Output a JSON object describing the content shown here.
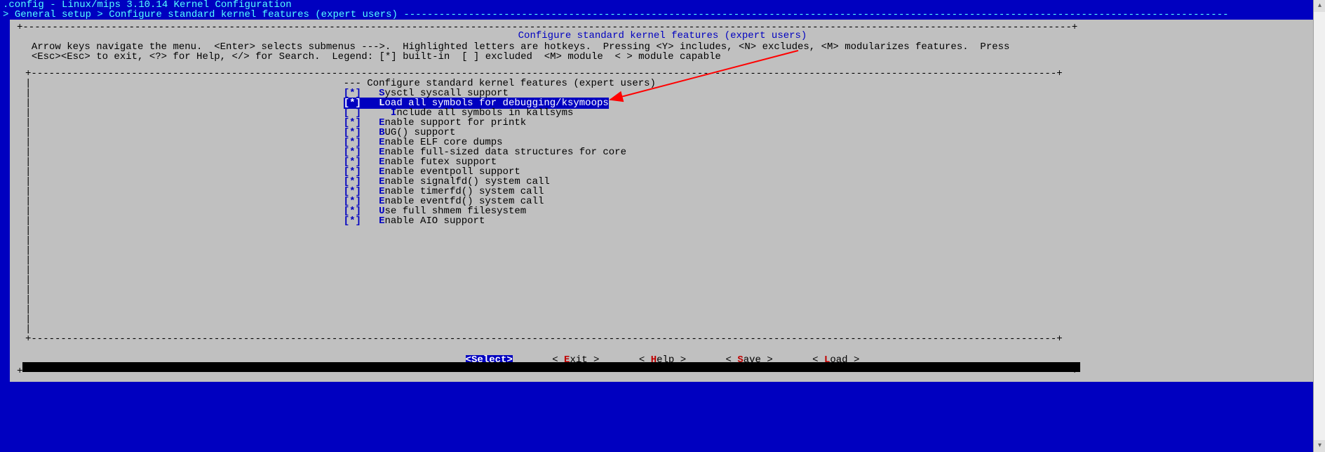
{
  "header": {
    "title": ".config - Linux/mips 3.10.14 Kernel Configuration",
    "breadcrumb_prefix": "> ",
    "breadcrumb": "General setup > Configure standard kernel features (expert users)"
  },
  "box": {
    "title": "Configure standard kernel features (expert users)",
    "help_line1": "  Arrow keys navigate the menu.  <Enter> selects submenus --->.  Highlighted letters are hotkeys.  Pressing <Y> includes, <N> excludes, <M> modularizes features.  Press",
    "help_line2": "  <Esc><Esc> to exit, <?> for Help, </> for Search.  Legend: [*] built-in  [ ] excluded  <M> module  < > module capable"
  },
  "menu": {
    "header_text": "--- Configure standard kernel features (expert users)",
    "items": [
      {
        "state": "[*]",
        "indent": "   ",
        "hotkey": "S",
        "rest": "ysctl syscall support",
        "selected": false
      },
      {
        "state": "[*]",
        "indent": "   ",
        "hotkey": "L",
        "rest": "oad all symbols for debugging/ksymoops",
        "selected": true
      },
      {
        "state": "[ ]",
        "indent": "     ",
        "hotkey": "I",
        "rest": "nclude all symbols in kallsyms",
        "selected": false
      },
      {
        "state": "[*]",
        "indent": "   ",
        "hotkey": "E",
        "rest": "nable support for printk",
        "selected": false
      },
      {
        "state": "[*]",
        "indent": "   ",
        "hotkey": "B",
        "rest": "UG() support",
        "selected": false
      },
      {
        "state": "[*]",
        "indent": "   ",
        "hotkey": "E",
        "rest": "nable ELF core dumps",
        "selected": false
      },
      {
        "state": "[*]",
        "indent": "   ",
        "hotkey": "E",
        "rest": "nable full-sized data structures for core",
        "selected": false
      },
      {
        "state": "[*]",
        "indent": "   ",
        "hotkey": "E",
        "rest": "nable futex support",
        "selected": false
      },
      {
        "state": "[*]",
        "indent": "   ",
        "hotkey": "E",
        "rest": "nable eventpoll support",
        "selected": false
      },
      {
        "state": "[*]",
        "indent": "   ",
        "hotkey": "E",
        "rest": "nable signalfd() system call",
        "selected": false
      },
      {
        "state": "[*]",
        "indent": "   ",
        "hotkey": "E",
        "rest": "nable timerfd() system call",
        "selected": false
      },
      {
        "state": "[*]",
        "indent": "   ",
        "hotkey": "E",
        "rest": "nable eventfd() system call",
        "selected": false
      },
      {
        "state": "[*]",
        "indent": "   ",
        "hotkey": "U",
        "rest": "se full shmem filesystem",
        "selected": false
      },
      {
        "state": "[*]",
        "indent": "   ",
        "hotkey": "E",
        "rest": "nable AIO support",
        "selected": false
      }
    ]
  },
  "buttons": {
    "select": "<Select>",
    "exit_pre": "< ",
    "exit_hot": "E",
    "exit_post": "xit >",
    "help_pre": "< ",
    "help_hot": "H",
    "help_post": "elp >",
    "save_pre": "< ",
    "save_hot": "S",
    "save_post": "ave >",
    "load_pre": "< ",
    "load_hot": "L",
    "load_post": "oad >"
  }
}
